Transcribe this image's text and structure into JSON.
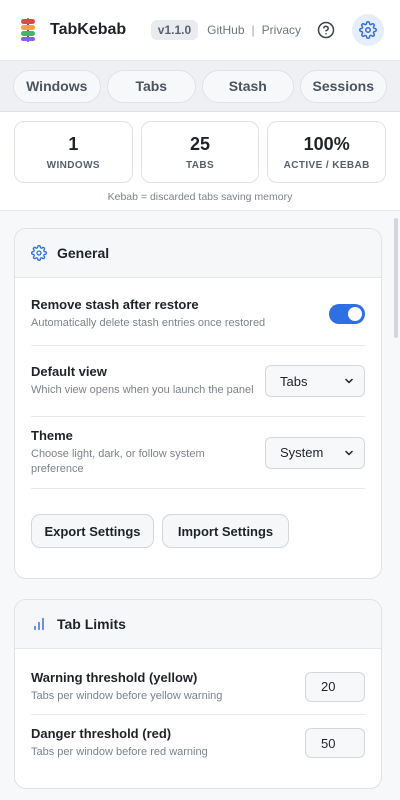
{
  "header": {
    "title": "TabKebab",
    "version": "v1.1.0",
    "links": [
      "GitHub",
      "Privacy"
    ],
    "separator": "|",
    "help_icon": "help-circle-icon",
    "settings_icon": "gear-icon"
  },
  "tabs": [
    {
      "label": "Windows"
    },
    {
      "label": "Tabs"
    },
    {
      "label": "Stash"
    },
    {
      "label": "Sessions"
    }
  ],
  "stats": [
    {
      "value": "1",
      "label": "WINDOWS"
    },
    {
      "value": "25",
      "label": "TABS"
    },
    {
      "value": "100%",
      "label": "ACTIVE / KEBAB"
    }
  ],
  "kebab_note": "Kebab = discarded tabs saving memory",
  "general": {
    "title": "General",
    "icon": "gear-icon",
    "remove_stash": {
      "title": "Remove stash after restore",
      "desc": "Automatically delete stash entries once restored",
      "enabled": true
    },
    "default_view": {
      "title": "Default view",
      "desc": "Which view opens when you launch the panel",
      "value": "Tabs"
    },
    "theme": {
      "title": "Theme",
      "desc": "Choose light, dark, or follow system preference",
      "value": "System"
    },
    "export_label": "Export Settings",
    "import_label": "Import Settings"
  },
  "tab_limits": {
    "title": "Tab Limits",
    "icon": "bar-chart-icon",
    "warning": {
      "title": "Warning threshold (yellow)",
      "desc": "Tabs per window before yellow warning",
      "value": "20"
    },
    "danger": {
      "title": "Danger threshold (red)",
      "desc": "Tabs per window before red warning",
      "value": "50"
    }
  },
  "colors": {
    "accent": "#2f6fe4",
    "toggle_on": "#2f6fe4"
  }
}
